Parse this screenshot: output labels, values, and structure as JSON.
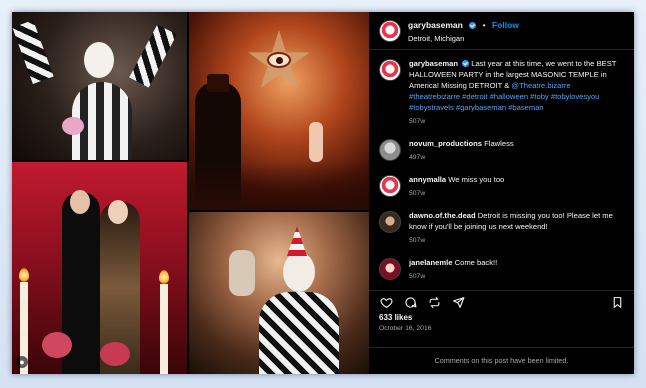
{
  "post": {
    "username": "garybaseman",
    "follow_label": "Follow",
    "location": "Detroit, Michigan",
    "caption_user": "garybaseman",
    "caption_text_1": "Last year at this time, we went to the BEST HALLOWEEN PARTY in the largest MASONIC TEMPLE in America! Missing DETROIT & ",
    "caption_mention": "@Theatre.bizarre",
    "caption_hashtags": "#theatrebizarre #detroit #halloween #toby #tobylovesyou #tobystravels #garybaseman #baseman",
    "caption_time": "507w",
    "likes": "633 likes",
    "date": "October 16, 2016",
    "limited_notice": "Comments on this post have been limited."
  },
  "comments": [
    {
      "user": "novum_productions",
      "text": "Flawless",
      "time": "497w"
    },
    {
      "user": "annymalla",
      "text": "We miss you too",
      "time": "507w"
    },
    {
      "user": "dawno.of.the.dead",
      "text": "Detroit is missing you too! Please let me know if you'll be joining us next weekend!",
      "time": "507w"
    },
    {
      "user": "janelanemle",
      "text": "Come back!!",
      "time": "507w"
    }
  ],
  "icons": {
    "like": "heart-icon",
    "comment": "comment-icon",
    "share": "repost-icon",
    "send": "send-icon",
    "save": "bookmark-icon"
  },
  "colors": {
    "link": "#0095f6",
    "hashtag": "#4fa3f5",
    "background": "#000000",
    "muted": "#a8a8a8"
  }
}
